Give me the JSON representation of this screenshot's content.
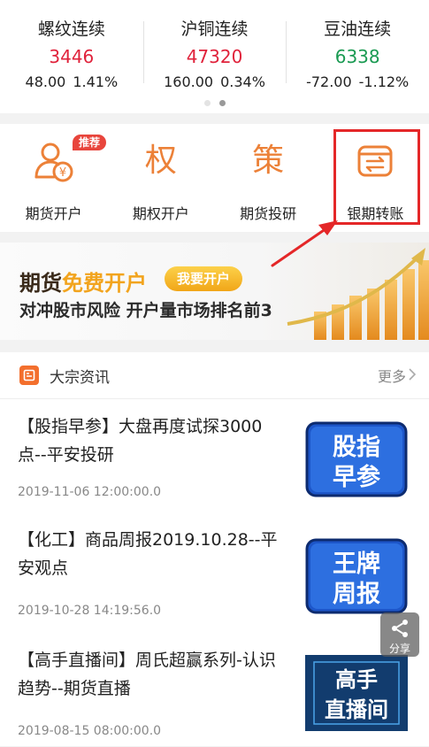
{
  "ticker": [
    {
      "name": "螺纹连续",
      "price": "3446",
      "change": "48.00",
      "percent": "1.41%",
      "trend": "up"
    },
    {
      "name": "沪铜连续",
      "price": "47320",
      "change": "160.00",
      "percent": "0.34%",
      "trend": "up"
    },
    {
      "name": "豆油连续",
      "price": "6338",
      "change": "-72.00",
      "percent": "-1.12%",
      "trend": "down"
    }
  ],
  "entries": [
    {
      "label": "期货开户",
      "badge": "推荐",
      "icon": "account-open-icon"
    },
    {
      "label": "期权开户",
      "glyph": "权",
      "icon": "options-icon"
    },
    {
      "label": "期货投研",
      "glyph": "策",
      "icon": "research-icon"
    },
    {
      "label": "银期转账",
      "icon": "bank-transfer-icon"
    }
  ],
  "banner": {
    "title_prefix": "期货",
    "title_highlight": "免费开户",
    "button": "我要开户",
    "subtitle": "对冲股市风险 开户量市场排名前3"
  },
  "news": {
    "header": "大宗资讯",
    "more": "更多",
    "items": [
      {
        "title": "【股指早参】大盘再度试探3000点--平安投研",
        "date": "2019-11-06 12:00:00.0",
        "thumb_line1": "股指",
        "thumb_line2": "早参"
      },
      {
        "title": "【化工】商品周报2019.10.28--平安观点",
        "date": "2019-10-28 14:19:56.0",
        "thumb_line1": "王牌",
        "thumb_line2": "周报"
      },
      {
        "title": "【高手直播间】周氏超赢系列-认识趋势--期货直播",
        "date": "2019-08-15 08:00:00.0",
        "thumb_line1": "高手",
        "thumb_line2": "直播间"
      }
    ]
  },
  "share_label": "分享",
  "colors": {
    "up": "#e0223b",
    "down": "#1a9a52",
    "accent": "#ec8138",
    "highlight": "#e42728"
  }
}
